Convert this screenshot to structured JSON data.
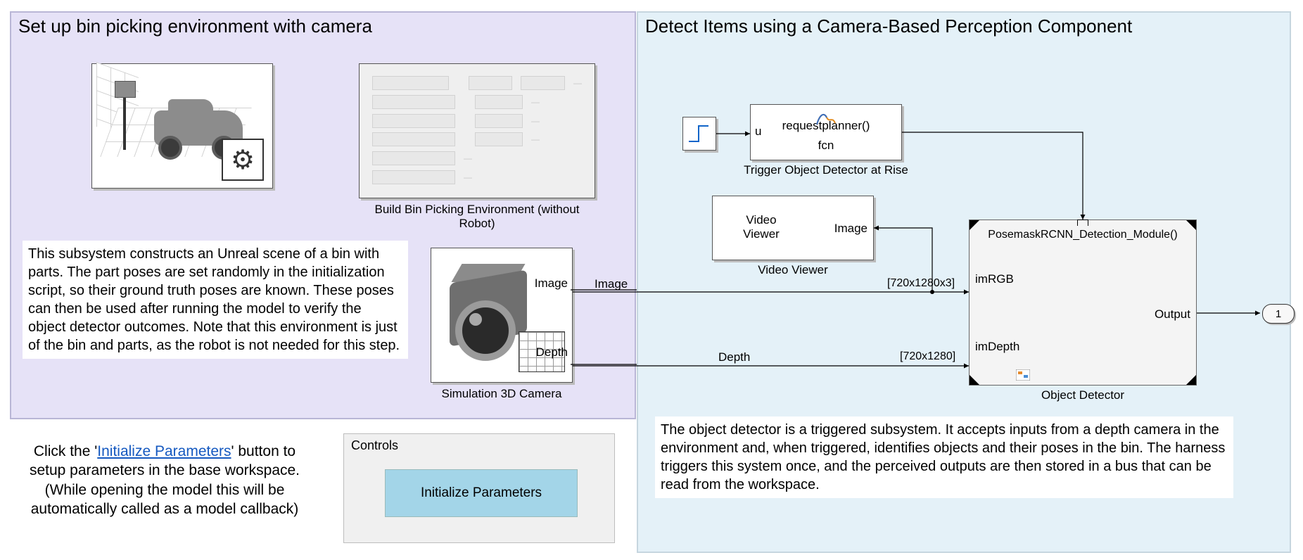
{
  "panels": {
    "env": {
      "title": "Set up bin picking environment with camera",
      "buildBlockLabel": "Build Bin Picking Environment (without Robot)",
      "cameraLabel": "Simulation 3D Camera",
      "imagePort": "Image",
      "depthPort": "Depth",
      "description": "This subsystem constructs an Unreal scene of a bin with parts. The part poses are set randomly in the initialization script, so their ground truth poses are known. These poses can then be used after running the model to verify the object detector outcomes. Note that this environment is just of the bin and parts, as the robot is not needed for this step."
    },
    "detect": {
      "title": "Detect Items using a Camera-Based Perception Component",
      "triggerLabel": "Trigger Object Detector at Rise",
      "triggerFn": "requestplanner()",
      "triggerFcn": "fcn",
      "triggerPort": "u",
      "videoViewerLabel": "Video Viewer",
      "videoViewerText": "Video\nViewer",
      "videoViewerPort": "Image",
      "detectorLabel": "Object Detector",
      "detectorFn": "PosemaskRCNN_Detection_Module()",
      "imRGBport": "imRGB",
      "imDepthport": "imDepth",
      "outputPort": "Output",
      "imageSignal": "Image",
      "depthSignal": "Depth",
      "rgbDim": "[720x1280x3]",
      "depthDim": "[720x1280]",
      "outport": "1",
      "description": "The object detector is a triggered subsystem. It accepts inputs from a depth camera in the environment and, when triggered, identifies objects and their poses in the bin. The harness triggers this system once, and the perceived outputs are then stored in a bus that can be read from the workspace."
    }
  },
  "footer": {
    "pre": "Click the '",
    "link": "Initialize Parameters",
    "post": "' button to setup parameters in the base workspace.  (While opening the model this will be automatically called as a model callback)"
  },
  "controls": {
    "title": "Controls",
    "button": "Initialize Parameters"
  }
}
